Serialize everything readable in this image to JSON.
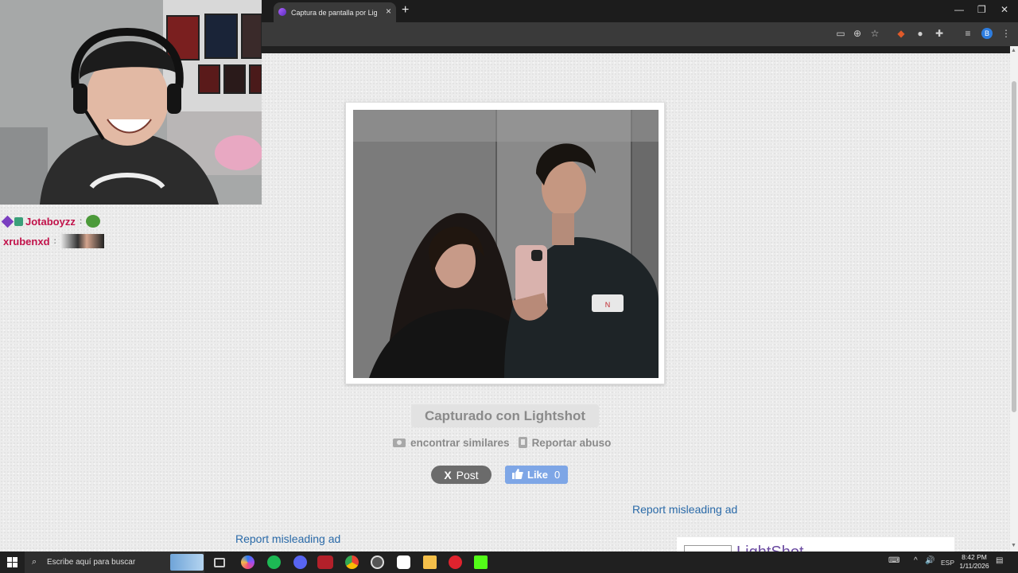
{
  "browser": {
    "tab_title": "Captura de pantalla por Lightshot",
    "tab_close": "×",
    "new_tab": "+"
  },
  "page": {
    "captured_label": "Capturado con Lightshot",
    "find_similar": "encontrar similares",
    "report_abuse": "Reportar abuso",
    "x_post": "Post",
    "x_glyph": "X",
    "fb_like": "Like",
    "fb_count": "0",
    "report_ad_1": "Report misleading ad",
    "report_ad_2": "Report misleading ad",
    "ad_text": "LightShot"
  },
  "chat": {
    "messages": [
      {
        "user": "Jotaboyzz",
        "colon": ":"
      },
      {
        "user": "xrubenxd",
        "colon": ":"
      }
    ]
  },
  "taskbar": {
    "search_placeholder": "Escribe aquí para buscar",
    "language": "ESP",
    "time": "8:42 PM",
    "date": "1/11/2026"
  },
  "colors": {
    "link": "#2a6aa8",
    "fb_button": "#7ea6e6",
    "x_button": "#6b6b6b",
    "chat_username": "#c1124a"
  },
  "icons": [
    "camera-icon",
    "clipboard-icon",
    "facebook-thumb-icon",
    "windows-start-icon",
    "search-icon",
    "chrome-icon",
    "spotify-icon",
    "discord-icon",
    "opera-icon",
    "file-explorer-icon"
  ]
}
